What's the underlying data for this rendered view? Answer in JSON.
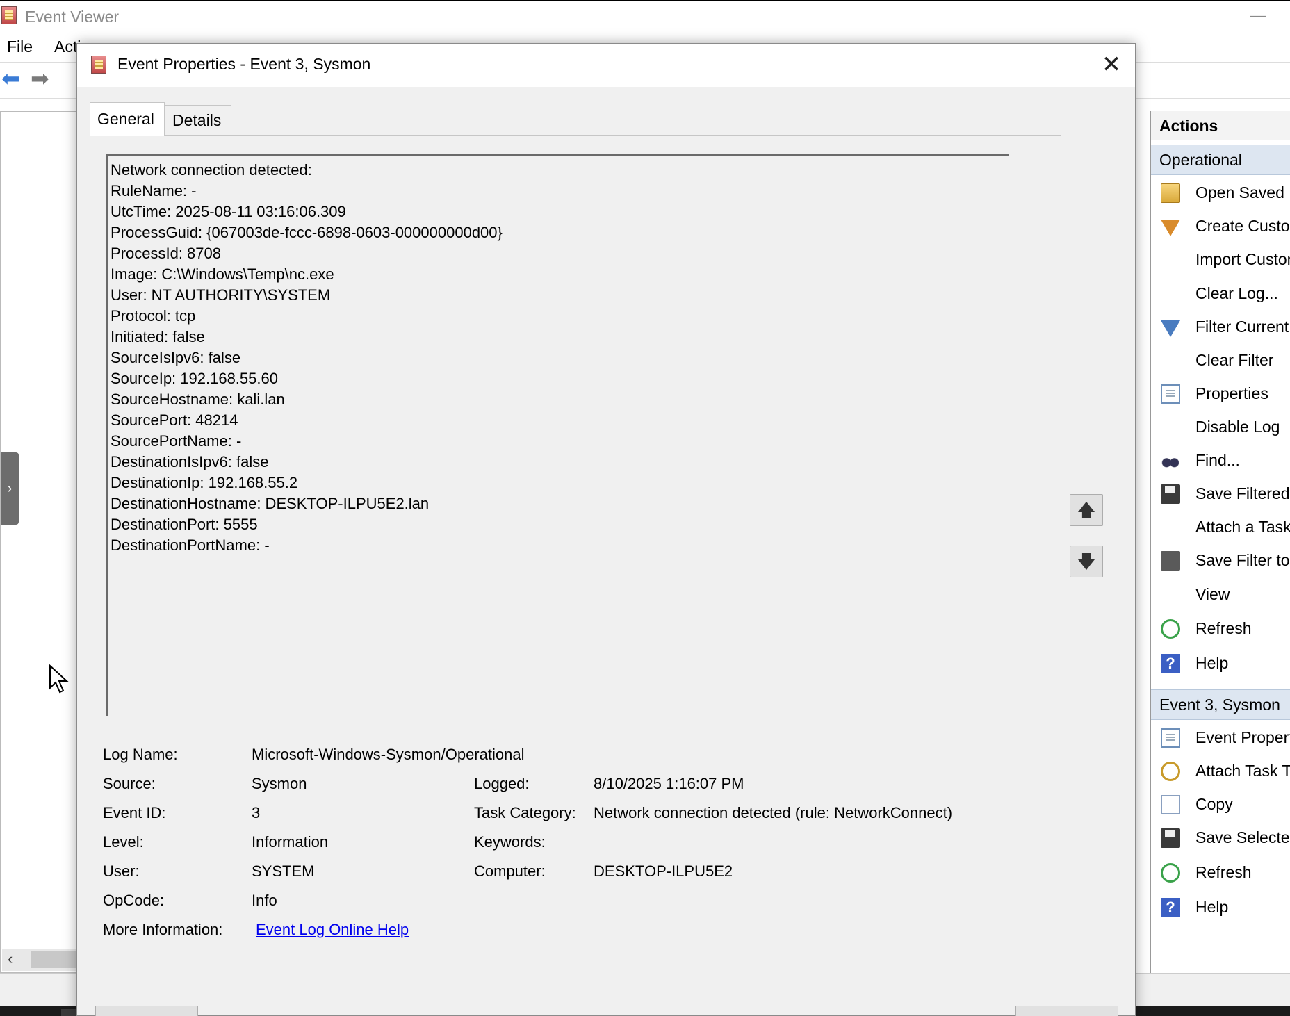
{
  "background_window": {
    "title": "Event Viewer",
    "menu": [
      "File",
      "Acti"
    ],
    "minimize_glyph": "—"
  },
  "actions": {
    "header": "Actions",
    "section_operational": "Operational",
    "operational_items": [
      {
        "label": "Open Saved Log...",
        "icon": "folder-open-icon"
      },
      {
        "label": "Create Custom View...",
        "icon": "filter-orange-icon"
      },
      {
        "label": "Import Custom View...",
        "icon": ""
      },
      {
        "label": "Clear Log...",
        "icon": ""
      },
      {
        "label": "Filter Current Log...",
        "icon": "filter-icon"
      },
      {
        "label": "Clear Filter",
        "icon": ""
      },
      {
        "label": "Properties",
        "icon": "properties-icon"
      },
      {
        "label": "Disable Log",
        "icon": ""
      },
      {
        "label": "Find...",
        "icon": "binoculars-icon"
      },
      {
        "label": "Save Filtered Log File As...",
        "icon": "save-icon"
      },
      {
        "label": "Attach a Task To this Log...",
        "icon": ""
      },
      {
        "label": "Save Filter to Custom View...",
        "icon": "save-filter-icon"
      },
      {
        "label": "View",
        "icon": ""
      },
      {
        "label": "Refresh",
        "icon": "refresh-icon"
      },
      {
        "label": "Help",
        "icon": "help-icon"
      }
    ],
    "section_event": "Event 3, Sysmon",
    "event_items": [
      {
        "label": "Event Properties",
        "icon": "properties-icon"
      },
      {
        "label": "Attach Task To This Event...",
        "icon": "clock-icon"
      },
      {
        "label": "Copy",
        "icon": "copy-icon"
      },
      {
        "label": "Save Selected Events...",
        "icon": "save-icon"
      },
      {
        "label": "Refresh",
        "icon": "refresh-icon"
      },
      {
        "label": "Help",
        "icon": "help-icon"
      }
    ]
  },
  "dialog": {
    "title": "Event Properties - Event 3, Sysmon",
    "close_glyph": "✕",
    "tabs": {
      "general": "General",
      "details": "Details"
    },
    "event_text": [
      "Network connection detected:",
      "RuleName: -",
      "UtcTime: 2025-08-11 03:16:06.309",
      "ProcessGuid: {067003de-fccc-6898-0603-000000000d00}",
      "ProcessId: 8708",
      "Image: C:\\Windows\\Temp\\nc.exe",
      "User: NT AUTHORITY\\SYSTEM",
      "Protocol: tcp",
      "Initiated: false",
      "SourceIsIpv6: false",
      "SourceIp: 192.168.55.60",
      "SourceHostname: kali.lan",
      "SourcePort: 48214",
      "SourcePortName: -",
      "DestinationIsIpv6: false",
      "DestinationIp: 192.168.55.2",
      "DestinationHostname: DESKTOP-ILPU5E2.lan",
      "DestinationPort: 5555",
      "DestinationPortName: -"
    ],
    "arrow_up": "🡅",
    "arrow_down": "🡇",
    "fields": {
      "log_name_label": "Log Name:",
      "log_name": "Microsoft-Windows-Sysmon/Operational",
      "source_label": "Source:",
      "source": "Sysmon",
      "logged_label": "Logged:",
      "logged": "8/10/2025 1:16:07 PM",
      "event_id_label": "Event ID:",
      "event_id": "3",
      "task_category_label": "Task Category:",
      "task_category": "Network connection detected (rule: NetworkConnect)",
      "level_label": "Level:",
      "level": "Information",
      "keywords_label": "Keywords:",
      "keywords": "",
      "user_label": "User:",
      "user": "SYSTEM",
      "computer_label": "Computer:",
      "computer": "DESKTOP-ILPU5E2",
      "opcode_label": "OpCode:",
      "opcode": "Info",
      "more_info_label": "More Information:",
      "more_info_link": "Event Log Online Help"
    }
  }
}
